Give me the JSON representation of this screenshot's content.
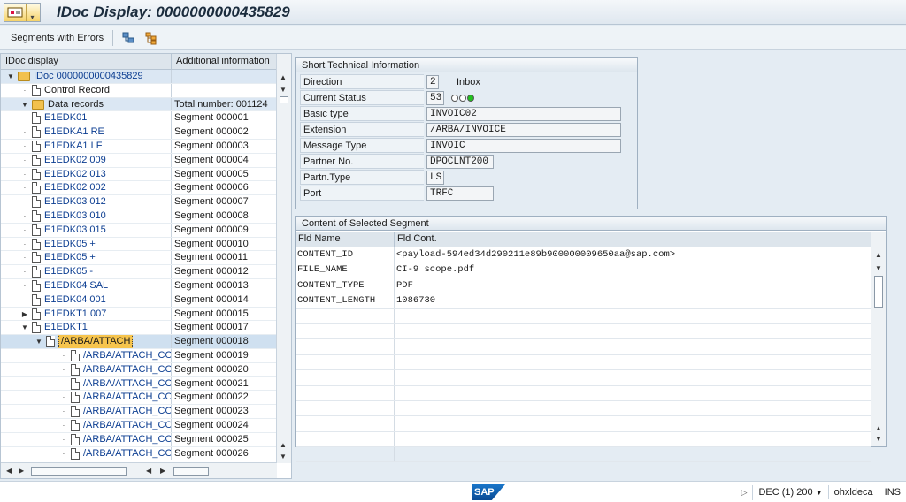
{
  "title": "IDoc Display: 0000000000435829",
  "toolbar": {
    "segments_with_errors": "Segments with Errors",
    "icons": [
      "tree-expand-icon",
      "hierarchy-icon"
    ]
  },
  "tree": {
    "col_idoc": "IDoc display",
    "col_info": "Additional information",
    "rows": [
      {
        "label": "IDoc 0000000000435829",
        "info": "",
        "indent": 0,
        "icon": "folder",
        "exp": "▼"
      },
      {
        "label": "Control Record",
        "info": "",
        "indent": 1,
        "icon": "doc",
        "exp": "·"
      },
      {
        "label": "Data records",
        "info": "Total number: 001124",
        "indent": 1,
        "icon": "folder",
        "exp": "▼"
      },
      {
        "label": "E1EDK01",
        "info": "Segment 000001",
        "indent": 2,
        "icon": "doc",
        "exp": "·"
      },
      {
        "label": "E1EDKA1 RE",
        "info": "Segment 000002",
        "indent": 2,
        "icon": "doc",
        "exp": "·"
      },
      {
        "label": "E1EDKA1 LF",
        "info": "Segment 000003",
        "indent": 2,
        "icon": "doc",
        "exp": "·"
      },
      {
        "label": "E1EDK02 009",
        "info": "Segment 000004",
        "indent": 2,
        "icon": "doc",
        "exp": "·"
      },
      {
        "label": "E1EDK02 013",
        "info": "Segment 000005",
        "indent": 2,
        "icon": "doc",
        "exp": "·"
      },
      {
        "label": "E1EDK02 002",
        "info": "Segment 000006",
        "indent": 2,
        "icon": "doc",
        "exp": "·"
      },
      {
        "label": "E1EDK03 012",
        "info": "Segment 000007",
        "indent": 2,
        "icon": "doc",
        "exp": "·"
      },
      {
        "label": "E1EDK03 010",
        "info": "Segment 000008",
        "indent": 2,
        "icon": "doc",
        "exp": "·"
      },
      {
        "label": "E1EDK03 015",
        "info": "Segment 000009",
        "indent": 2,
        "icon": "doc",
        "exp": "·"
      },
      {
        "label": "E1EDK05 +",
        "info": "Segment 000010",
        "indent": 2,
        "icon": "doc",
        "exp": "·"
      },
      {
        "label": "E1EDK05 +",
        "info": "Segment 000011",
        "indent": 2,
        "icon": "doc",
        "exp": "·"
      },
      {
        "label": "E1EDK05 -",
        "info": "Segment 000012",
        "indent": 2,
        "icon": "doc",
        "exp": "·"
      },
      {
        "label": "E1EDK04 SAL",
        "info": "Segment 000013",
        "indent": 2,
        "icon": "doc",
        "exp": "·"
      },
      {
        "label": "E1EDK04 001",
        "info": "Segment 000014",
        "indent": 2,
        "icon": "doc",
        "exp": "·"
      },
      {
        "label": "E1EDKT1 007",
        "info": "Segment 000015",
        "indent": 2,
        "icon": "doc",
        "exp": "▶"
      },
      {
        "label": "E1EDKT1",
        "info": "Segment 000017",
        "indent": 2,
        "icon": "doc",
        "exp": "▼"
      },
      {
        "label": "/ARBA/ATTACH",
        "info": "Segment 000018",
        "indent": 3,
        "icon": "doc",
        "exp": "▼"
      },
      {
        "label": "/ARBA/ATTACH_CON",
        "info": "Segment 000019",
        "indent": 4,
        "icon": "doc",
        "exp": "·"
      },
      {
        "label": "/ARBA/ATTACH_CON",
        "info": "Segment 000020",
        "indent": 4,
        "icon": "doc",
        "exp": "·"
      },
      {
        "label": "/ARBA/ATTACH_CON",
        "info": "Segment 000021",
        "indent": 4,
        "icon": "doc",
        "exp": "·"
      },
      {
        "label": "/ARBA/ATTACH_CON",
        "info": "Segment 000022",
        "indent": 4,
        "icon": "doc",
        "exp": "·"
      },
      {
        "label": "/ARBA/ATTACH_CON",
        "info": "Segment 000023",
        "indent": 4,
        "icon": "doc",
        "exp": "·"
      },
      {
        "label": "/ARBA/ATTACH_CON",
        "info": "Segment 000024",
        "indent": 4,
        "icon": "doc",
        "exp": "·"
      },
      {
        "label": "/ARBA/ATTACH_CON",
        "info": "Segment 000025",
        "indent": 4,
        "icon": "doc",
        "exp": "·"
      },
      {
        "label": "/ARBA/ATTACH_CON",
        "info": "Segment 000026",
        "indent": 4,
        "icon": "doc",
        "exp": "·"
      }
    ]
  },
  "sti": {
    "header": "Short Technical Information",
    "fields": [
      {
        "label": "Direction",
        "value": "2",
        "extra": "Inbox"
      },
      {
        "label": "Current Status",
        "value": "53",
        "extra": ""
      },
      {
        "label": "Basic type",
        "value": "INVOIC02",
        "extra": ""
      },
      {
        "label": "Extension",
        "value": "/ARBA/INVOICE",
        "extra": ""
      },
      {
        "label": "Message Type",
        "value": "INVOIC",
        "extra": ""
      },
      {
        "label": "Partner No.",
        "value": "DPOCLNT200",
        "extra": ""
      },
      {
        "label": "Partn.Type",
        "value": "LS",
        "extra": ""
      },
      {
        "label": "Port",
        "value": "TRFC",
        "extra": ""
      }
    ]
  },
  "content": {
    "header": "Content of Selected Segment",
    "col_name": "Fld Name",
    "col_cont": "Fld Cont.",
    "rows": [
      {
        "name": "CONTENT_ID",
        "value": "<payload-594ed34d290211e89b900000009650aa@sap.com>"
      },
      {
        "name": "FILE_NAME",
        "value": "CI-9 scope.pdf"
      },
      {
        "name": "CONTENT_TYPE",
        "value": "PDF"
      },
      {
        "name": "CONTENT_LENGTH",
        "value": "1086730"
      }
    ],
    "empty_rows": 10
  },
  "status": {
    "logo": "SAP",
    "system": "DEC (1) 200",
    "host": "ohxldeca",
    "mode": "INS"
  }
}
